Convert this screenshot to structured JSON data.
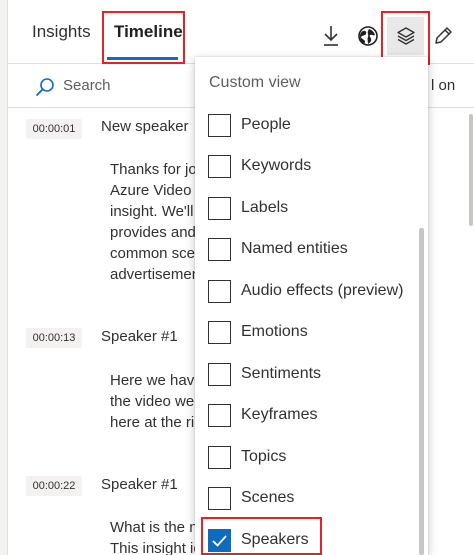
{
  "tabs": {
    "insights": "Insights",
    "timeline": "Timeline"
  },
  "toolbar": {
    "icons": [
      "download-icon",
      "globe-icon",
      "layers-icon",
      "pencil-icon"
    ]
  },
  "search": {
    "placeholder": "Search",
    "tail_text": "l on"
  },
  "transcript": [
    {
      "time": "00:00:01",
      "speaker": "New speaker",
      "lines": [
        "Thanks for jo",
        "Azure Video",
        "insight. We'll",
        "provides and",
        "common sce",
        "advertisemen"
      ]
    },
    {
      "time": "00:00:13",
      "speaker": "Speaker #1",
      "lines": [
        "Here we have",
        "the video we",
        "here at the ri"
      ]
    },
    {
      "time": "00:00:22",
      "speaker": "Speaker #1",
      "lines": [
        "What is the n",
        "This insight io"
      ]
    }
  ],
  "custom_view": {
    "title": "Custom view",
    "options": [
      {
        "label": "People",
        "checked": false
      },
      {
        "label": "Keywords",
        "checked": false
      },
      {
        "label": "Labels",
        "checked": false
      },
      {
        "label": "Named entities",
        "checked": false
      },
      {
        "label": "Audio effects (preview)",
        "checked": false
      },
      {
        "label": "Emotions",
        "checked": false
      },
      {
        "label": "Sentiments",
        "checked": false
      },
      {
        "label": "Keyframes",
        "checked": false
      },
      {
        "label": "Topics",
        "checked": false
      },
      {
        "label": "Scenes",
        "checked": false
      },
      {
        "label": "Speakers",
        "checked": true
      }
    ]
  },
  "colors": {
    "accent": "#0f6cbd",
    "highlight": "#e0242a"
  }
}
